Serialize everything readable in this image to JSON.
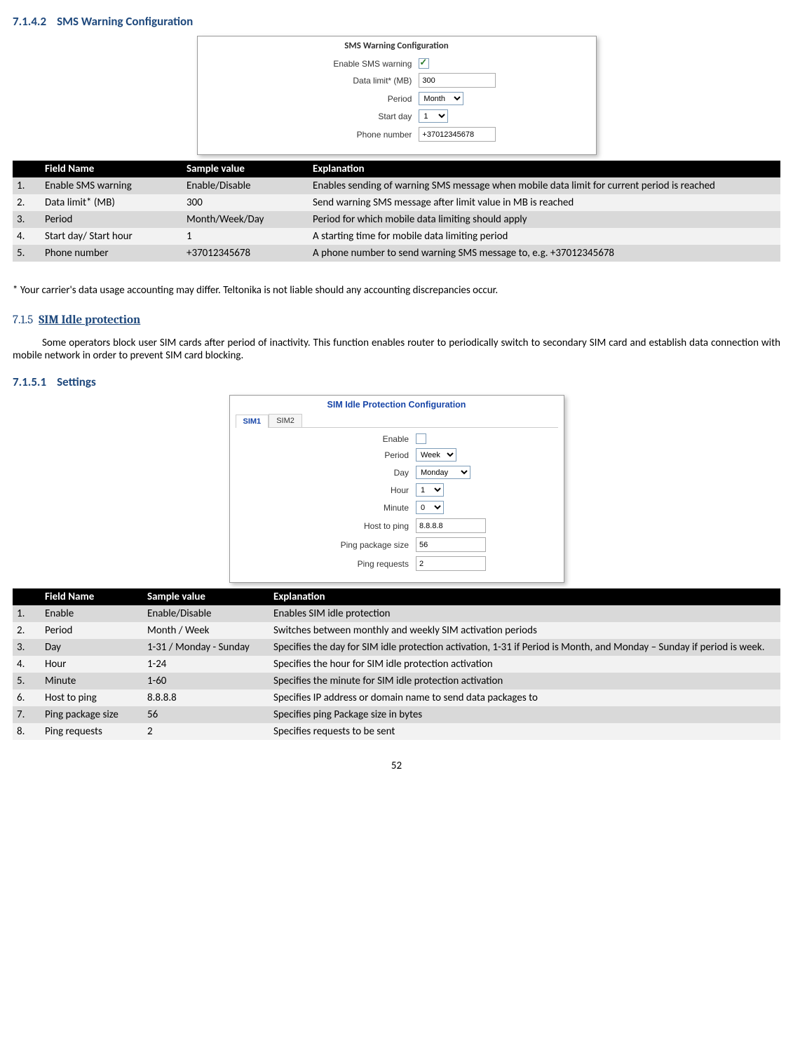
{
  "headings": {
    "h71412_num": "7.1.4.2",
    "h71412_txt": "SMS Warning Configuration",
    "h715_num": "7.1.5",
    "h715_txt": "SIM Idle protection",
    "h7151_num": "7.1.5.1",
    "h7151_txt": "Settings"
  },
  "screenshot1": {
    "title": "SMS Warning Configuration",
    "rows": {
      "enable_label": "Enable SMS warning",
      "datalimit_label": "Data limit* (MB)",
      "datalimit_value": "300",
      "period_label": "Period",
      "period_value": "Month",
      "startday_label": "Start day",
      "startday_value": "1",
      "phone_label": "Phone number",
      "phone_value": "+37012345678"
    }
  },
  "table1": {
    "headers": {
      "field": "Field Name",
      "sample": "Sample value",
      "explanation": "Explanation"
    },
    "rows": [
      {
        "n": "1.",
        "field": "Enable SMS warning",
        "sample": "Enable/Disable",
        "exp": "Enables sending of warning SMS message when mobile data limit for current period is reached"
      },
      {
        "n": "2.",
        "field": "Data limit* (MB)",
        "sample": "300",
        "exp": "Send warning SMS message after limit value in MB is reached"
      },
      {
        "n": "3.",
        "field": "Period",
        "sample": "Month/Week/Day",
        "exp": "Period for which mobile data limiting should apply"
      },
      {
        "n": "4.",
        "field": "Start day/ Start hour",
        "sample": "1",
        "exp": "A starting time for mobile data limiting period"
      },
      {
        "n": "5.",
        "field": "Phone number",
        "sample": "+37012345678",
        "exp": "A phone number to send warning SMS message to, e.g. +37012345678"
      }
    ]
  },
  "note1": "* Your carrier's data usage accounting may differ. Teltonika is not liable should any accounting discrepancies occur.",
  "para715": "Some operators block user SIM cards after period of inactivity. This function enables router to periodically switch to secondary SIM card and establish data connection with mobile network in order to prevent SIM card blocking.",
  "screenshot2": {
    "title": "SIM Idle Protection Configuration",
    "tabs": {
      "sim1": "SIM1",
      "sim2": "SIM2"
    },
    "rows": {
      "enable_label": "Enable",
      "period_label": "Period",
      "period_value": "Week",
      "day_label": "Day",
      "day_value": "Monday",
      "hour_label": "Hour",
      "hour_value": "1",
      "minute_label": "Minute",
      "minute_value": "0",
      "host_label": "Host to ping",
      "host_value": "8.8.8.8",
      "pkgsize_label": "Ping package size",
      "pkgsize_value": "56",
      "pingreq_label": "Ping requests",
      "pingreq_value": "2"
    }
  },
  "table2": {
    "headers": {
      "field": "Field Name",
      "sample": "Sample value",
      "explanation": "Explanation"
    },
    "rows": [
      {
        "n": "1.",
        "field": "Enable",
        "sample": "Enable/Disable",
        "exp": "Enables SIM idle protection"
      },
      {
        "n": "2.",
        "field": "Period",
        "sample": "Month / Week",
        "exp": "Switches between monthly and weekly SIM activation periods"
      },
      {
        "n": "3.",
        "field": "Day",
        "sample": "1-31 / Monday - Sunday",
        "exp": "Specifies the day for SIM idle protection activation, 1-31 if Period is Month, and Monday – Sunday if period is week."
      },
      {
        "n": "4.",
        "field": "Hour",
        "sample": "1-24",
        "exp": "Specifies the hour for SIM idle protection activation"
      },
      {
        "n": "5.",
        "field": "Minute",
        "sample": "1-60",
        "exp": "Specifies the minute for SIM idle protection activation"
      },
      {
        "n": "6.",
        "field": "Host to ping",
        "sample": "8.8.8.8",
        "exp": "Specifies IP address or domain name to send data packages to"
      },
      {
        "n": "7.",
        "field": "Ping package size",
        "sample": "56",
        "exp": "Specifies ping Package size in bytes"
      },
      {
        "n": "8.",
        "field": "Ping requests",
        "sample": "2",
        "exp": "Specifies requests to be sent"
      }
    ]
  },
  "page_number": "52"
}
